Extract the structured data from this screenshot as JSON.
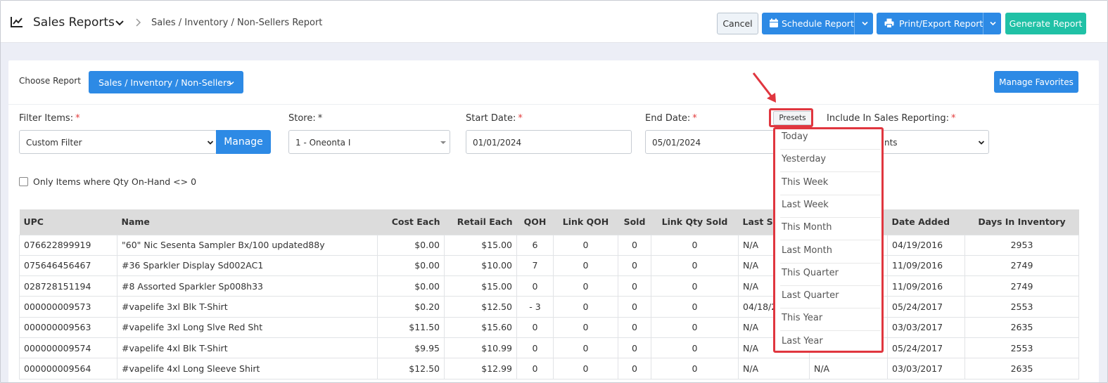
{
  "header": {
    "title": "Sales Reports",
    "breadcrumb": "Sales / Inventory / Non-Sellers Report",
    "buttons": {
      "cancel": "Cancel",
      "schedule": "Schedule Report",
      "print_export": "Print/Export Report",
      "generate": "Generate Report"
    }
  },
  "report": {
    "choose_label": "Choose Report",
    "selected": "Sales / Inventory / Non-Sellers",
    "manage_favorites": "Manage Favorites"
  },
  "filters": {
    "filter_items": {
      "label": "Filter Items:",
      "required": "*",
      "value": "Custom Filter",
      "manage": "Manage"
    },
    "store": {
      "label": "Store:",
      "required": "*",
      "value": "1 - Oneonta I"
    },
    "start_date": {
      "label": "Start Date:",
      "required": "*",
      "value": "01/01/2024"
    },
    "end_date": {
      "label": "End Date:",
      "required": "*",
      "value": "05/01/2024"
    },
    "presets_label": "Presets",
    "include_sales": {
      "label": "Include In Sales Reporting:",
      "required": "*",
      "value": "nts"
    },
    "only_qty_label": "Only Items where Qty On-Hand <> 0"
  },
  "presets": [
    "Today",
    "Yesterday",
    "This Week",
    "Last Week",
    "This Month",
    "Last Month",
    "This Quarter",
    "Last Quarter",
    "This Year",
    "Last Year"
  ],
  "table": {
    "columns": [
      "UPC",
      "Name",
      "Cost Each",
      "Retail Each",
      "QOH",
      "Link QOH",
      "Sold",
      "Link Qty Sold",
      "Last So",
      "",
      "Date Added",
      "Days In Inventory"
    ],
    "rows": [
      [
        "076622899919",
        "\"60\" Nic Sesenta Sampler Bx/100 updated88y",
        "$0.00",
        "$15.00",
        "6",
        "0",
        "0",
        "0",
        "N/A",
        "",
        "04/19/2016",
        "2953"
      ],
      [
        "075646456467",
        "#36 Sparkler Display Sd002AC1",
        "$0.00",
        "$10.00",
        "7",
        "0",
        "0",
        "0",
        "N/A",
        "",
        "11/09/2016",
        "2749"
      ],
      [
        "028728151194",
        "#8 Assorted Sparkler Sp008h33",
        "$0.00",
        "$15.00",
        "0",
        "0",
        "0",
        "0",
        "N/A",
        "",
        "11/09/2016",
        "2749"
      ],
      [
        "000000009573",
        "#vapelife 3xl Blk T-Shirt",
        "$0.20",
        "$12.50",
        "- 3",
        "0",
        "0",
        "0",
        "04/18/2",
        "",
        "05/24/2017",
        "2553"
      ],
      [
        "000000009563",
        "#vapelife 3xl Long Slve Red Sht",
        "$11.50",
        "$15.60",
        "0",
        "0",
        "0",
        "0",
        "N/A",
        "",
        "03/03/2017",
        "2635"
      ],
      [
        "000000009574",
        "#vapelife 4xl Blk T-Shirt",
        "$9.95",
        "$10.99",
        "0",
        "0",
        "0",
        "0",
        "N/A",
        "",
        "05/24/2017",
        "2553"
      ],
      [
        "000000009564",
        "#vapelife 4xl Long Sleeve Shirt",
        "$12.50",
        "$12.99",
        "0",
        "0",
        "0",
        "0",
        "N/A",
        "N/A",
        "03/03/2017",
        "2635"
      ]
    ]
  },
  "colors": {
    "primary": "#2d8ae5",
    "success": "#20c1a6",
    "highlight": "#e0363f",
    "table_header": "#dcdcdc"
  }
}
